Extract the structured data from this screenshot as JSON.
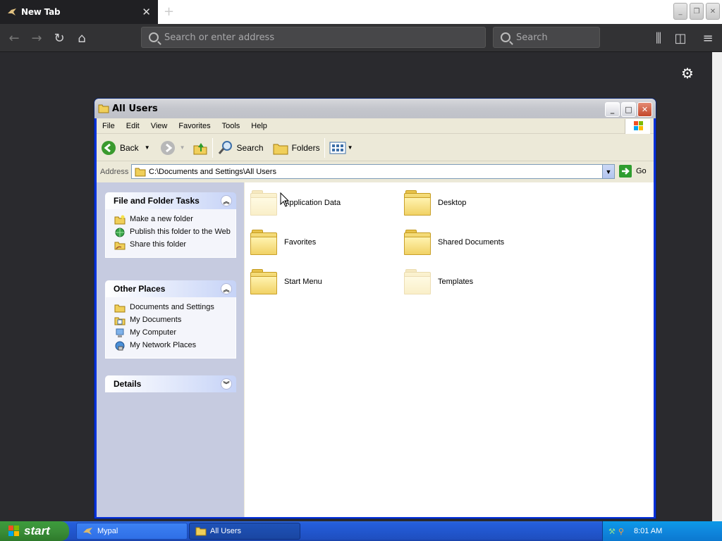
{
  "browser": {
    "tab_title": "New Tab",
    "tab_close": "✕",
    "new_tab": "+",
    "url_placeholder": "Search or enter address",
    "search_placeholder": "Search"
  },
  "window": {
    "title": "All Users",
    "menu": [
      "File",
      "Edit",
      "View",
      "Favorites",
      "Tools",
      "Help"
    ],
    "toolbar": {
      "back": "Back",
      "search": "Search",
      "folders": "Folders"
    },
    "address_label": "Address",
    "address_value": "C:\\Documents and Settings\\All Users",
    "go_label": "Go"
  },
  "taskpane": {
    "file_tasks": {
      "title": "File and Folder Tasks",
      "items": [
        "Make a new folder",
        "Publish this folder to the Web",
        "Share this folder"
      ]
    },
    "other_places": {
      "title": "Other Places",
      "items": [
        "Documents and Settings",
        "My Documents",
        "My Computer",
        "My Network Places"
      ]
    },
    "details": {
      "title": "Details"
    }
  },
  "files": [
    {
      "name": "Application Data",
      "ghost": true
    },
    {
      "name": "Desktop",
      "ghost": false
    },
    {
      "name": "Favorites",
      "ghost": false
    },
    {
      "name": "Shared Documents",
      "ghost": false
    },
    {
      "name": "Start Menu",
      "ghost": false
    },
    {
      "name": "Templates",
      "ghost": true
    }
  ],
  "taskbar": {
    "start": "start",
    "items": [
      "Mypal",
      "All Users"
    ],
    "clock": "8:01 AM"
  },
  "colors": {
    "xp_blue": "#0831d9",
    "taskbar_blue": "#245edc",
    "start_green": "#3a8e38",
    "folder_yellow": "#f1d265"
  }
}
